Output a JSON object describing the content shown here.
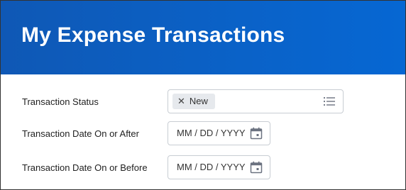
{
  "header": {
    "title": "My Expense Transactions",
    "background_color": "#0a5fc2"
  },
  "filters": {
    "status": {
      "label": "Transaction Status",
      "selected": [
        {
          "remove_icon": "close-icon",
          "value": "New"
        }
      ],
      "list_icon": "list-icon"
    },
    "date_after": {
      "label": "Transaction Date On or After",
      "placeholder": "MM / DD / YYYY",
      "icon": "calendar-icon"
    },
    "date_before": {
      "label": "Transaction Date On or Before",
      "placeholder": "MM / DD / YYYY",
      "icon": "calendar-icon"
    }
  },
  "colors": {
    "accent": "#0a5fc2",
    "field_border": "#c8cdd3",
    "pill_background": "#e6e9ed",
    "icon": "#6b7280"
  }
}
